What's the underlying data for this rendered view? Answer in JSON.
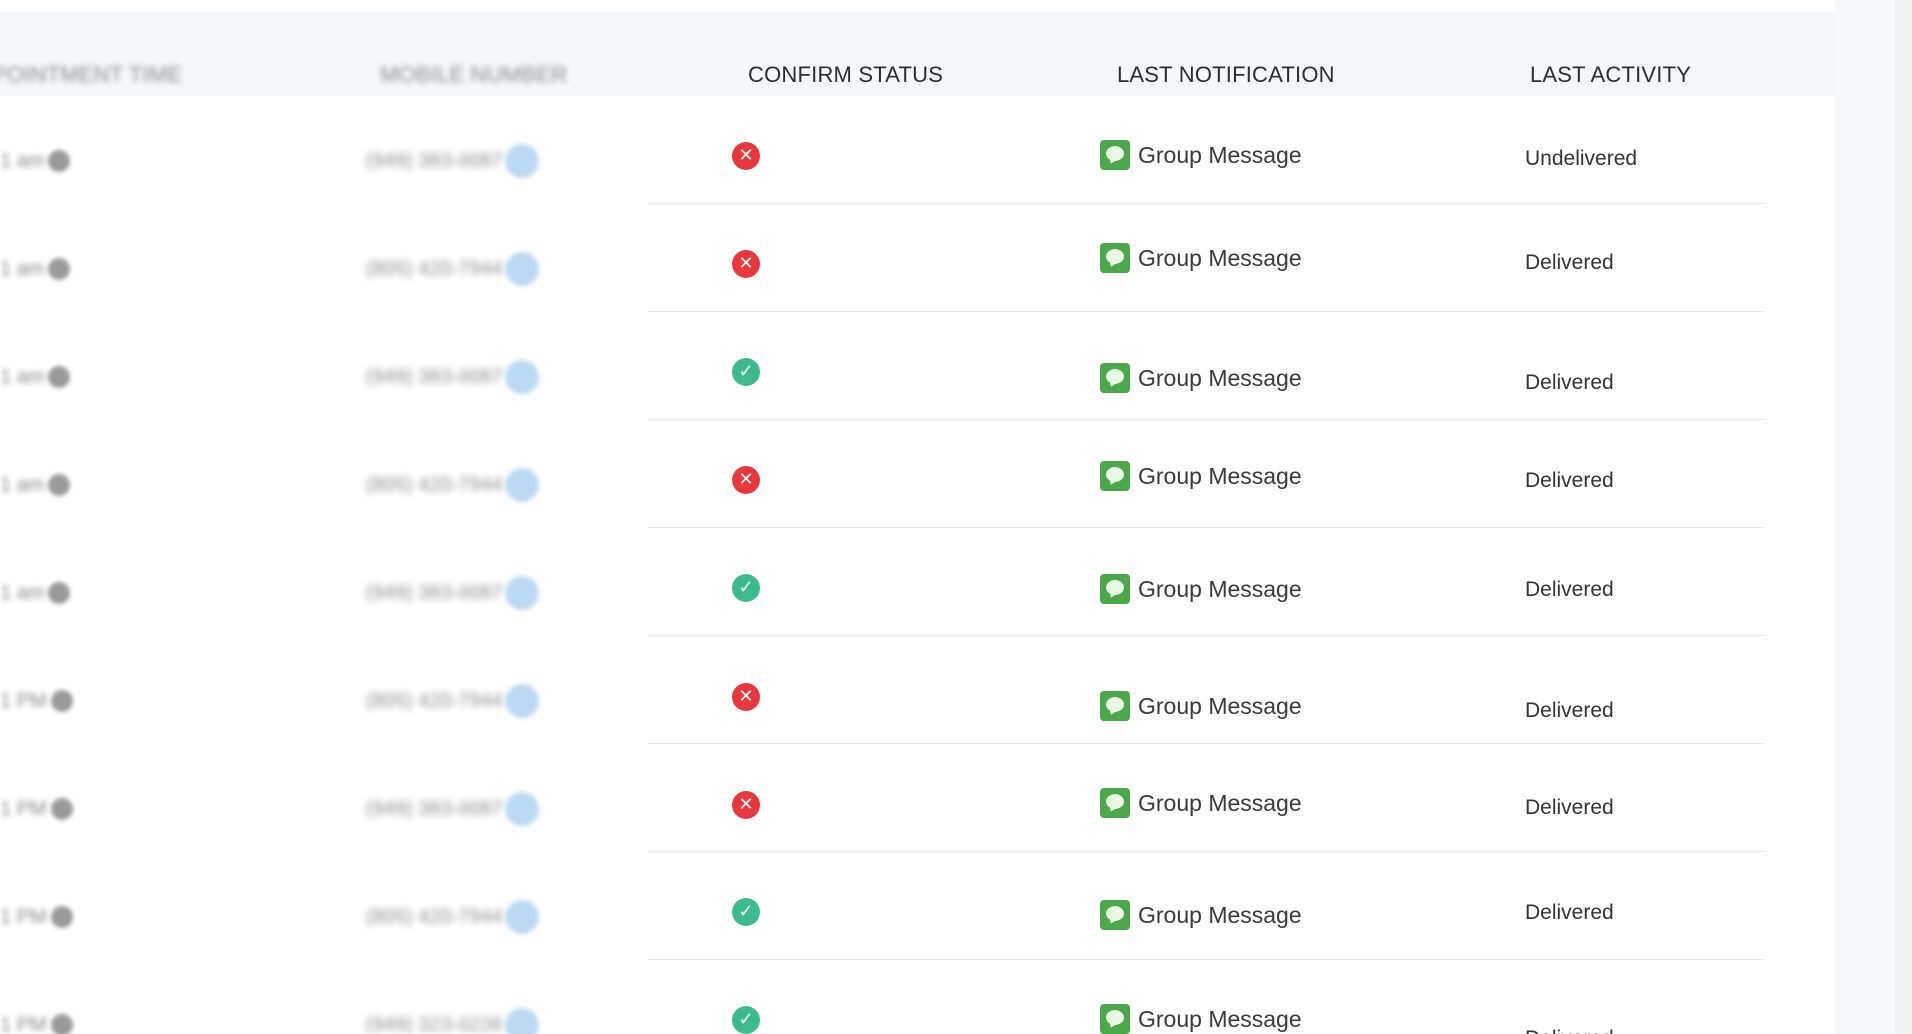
{
  "table": {
    "headers": {
      "appointment_time": "POINTMENT TIME",
      "mobile_number": "MOBILE NUMBER",
      "confirm_status": "CONFIRM STATUS",
      "last_notification": "LAST NOTIFICATION",
      "last_activity": "LAST ACTIVITY"
    },
    "rows": [
      {
        "time": "1 am",
        "phone": "(949) 383-0087",
        "status": "declined",
        "status_glyph": "✕",
        "notification": "Group Message",
        "activity": "Undelivered"
      },
      {
        "time": "1 am",
        "phone": "(805) 420-7944",
        "status": "declined",
        "status_glyph": "✕",
        "notification": "Group Message",
        "activity": "Delivered"
      },
      {
        "time": "1 am",
        "phone": "(949) 383-0087",
        "status": "confirmed",
        "status_glyph": "✓",
        "notification": "Group Message",
        "activity": "Delivered"
      },
      {
        "time": "1 am",
        "phone": "(805) 420-7944",
        "status": "declined",
        "status_glyph": "✕",
        "notification": "Group Message",
        "activity": "Delivered"
      },
      {
        "time": "1 am",
        "phone": "(949) 383-0087",
        "status": "confirmed",
        "status_glyph": "✓",
        "notification": "Group Message",
        "activity": "Delivered"
      },
      {
        "time": "1 PM",
        "phone": "(805) 420-7944",
        "status": "declined",
        "status_glyph": "✕",
        "notification": "Group Message",
        "activity": "Delivered"
      },
      {
        "time": "1 PM",
        "phone": "(949) 383-0087",
        "status": "declined",
        "status_glyph": "✕",
        "notification": "Group Message",
        "activity": "Delivered"
      },
      {
        "time": "1 PM",
        "phone": "(805) 420-7944",
        "status": "confirmed",
        "status_glyph": "✓",
        "notification": "Group Message",
        "activity": "Delivered"
      },
      {
        "time": "1 PM",
        "phone": "(949) 323-0226",
        "status": "confirmed",
        "status_glyph": "✓",
        "notification": "Group Message",
        "activity": "Delivered"
      }
    ]
  },
  "icons": {
    "declined": "x-circle-icon",
    "confirmed": "check-circle-icon",
    "notification": "message-bubble-icon",
    "time": "clock-icon",
    "phone": "chat-icon"
  },
  "colors": {
    "declined": "#e8383d",
    "confirmed": "#3dbb8e",
    "message_icon": "#4aa84a",
    "header_background": "#f4f8fb"
  }
}
